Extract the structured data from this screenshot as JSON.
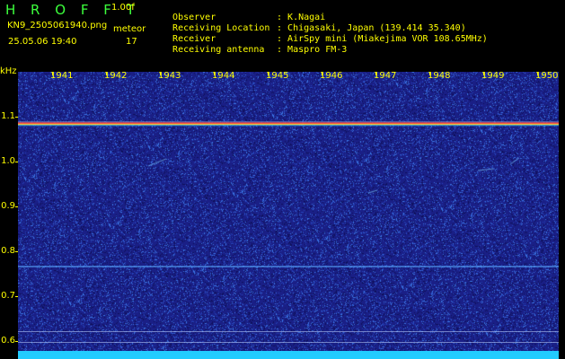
{
  "header": {
    "app_title": "H R O F F T",
    "version": "1.00f",
    "filename": "KN9_2505061940.png",
    "mode": "meteor",
    "datetime": "25.05.06 19:40",
    "count": "17"
  },
  "info": [
    {
      "label": "Observer",
      "value": "K.Nagai"
    },
    {
      "label": "Receiving Location",
      "value": "Chigasaki, Japan (139.414 35.340)"
    },
    {
      "label": "Receiver",
      "value": "AirSpy mini (Miakejima VOR 108.65MHz)"
    },
    {
      "label": "Receiving antenna",
      "value": "Maspro FM-3"
    }
  ],
  "info_separator": ":",
  "spectrogram": {
    "unit": "kHz",
    "x_ticks": [
      "1941",
      "1942",
      "1943",
      "1944",
      "1945",
      "1946",
      "1947",
      "1948",
      "1949",
      "1950"
    ],
    "y_ticks": [
      "1.1",
      "1.0",
      "0.9",
      "0.8",
      "0.7",
      "0.6"
    ],
    "y_range_khz": [
      0.57,
      1.17
    ],
    "background_color": "#1a1f86",
    "signal_color": "#ff3d3d",
    "noise_band_color": "#22ccff"
  }
}
